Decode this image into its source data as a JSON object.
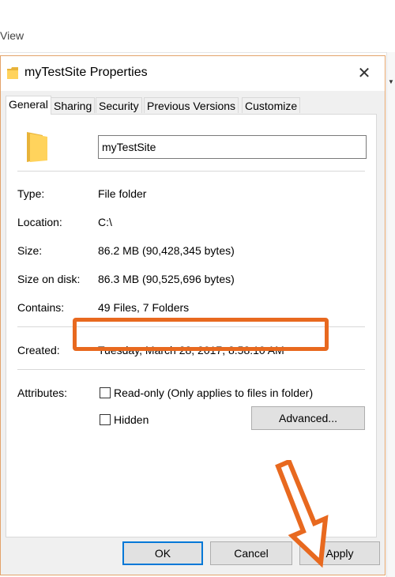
{
  "background": {
    "menu_partial": "View"
  },
  "dialog": {
    "title": "myTestSite Properties",
    "close_glyph": "✕",
    "tabs": [
      {
        "label": "General",
        "active": true
      },
      {
        "label": "Sharing",
        "active": false
      },
      {
        "label": "Security",
        "active": false
      },
      {
        "label": "Previous Versions",
        "active": false
      },
      {
        "label": "Customize",
        "active": false
      }
    ],
    "name_value": "myTestSite",
    "rows": {
      "type": {
        "label": "Type:",
        "value": "File folder"
      },
      "location": {
        "label": "Location:",
        "value": "C:\\"
      },
      "size": {
        "label": "Size:",
        "value": "86.2 MB (90,428,345 bytes)"
      },
      "size_on_disk": {
        "label": "Size on disk:",
        "value": "86.3 MB (90,525,696 bytes)"
      },
      "contains": {
        "label": "Contains:",
        "value": "49 Files, 7 Folders"
      },
      "created": {
        "label": "Created:",
        "value": "Tuesday, March 28, 2017, 8:58:10 AM"
      }
    },
    "attributes": {
      "label": "Attributes:",
      "readonly_label": "Read-only (Only applies to files in folder)",
      "readonly_checked": false,
      "hidden_label": "Hidden",
      "hidden_checked": false,
      "advanced_label": "Advanced..."
    },
    "buttons": {
      "ok": "OK",
      "cancel": "Cancel",
      "apply": "Apply"
    }
  },
  "colors": {
    "highlight": "#e8691f",
    "focus_border": "#0078d7",
    "folder": "#ffd35c"
  }
}
